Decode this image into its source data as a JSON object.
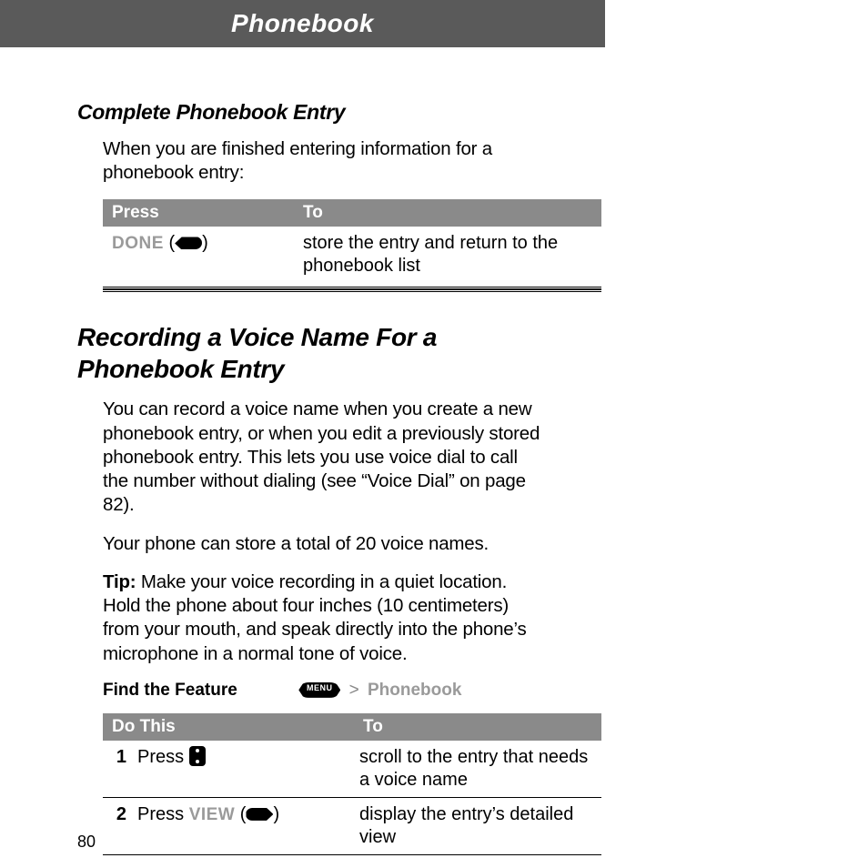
{
  "header": {
    "title": "Phonebook"
  },
  "page_number": "80",
  "section1": {
    "title": "Complete Phonebook Entry",
    "intro": "When you are finished entering information for a phonebook entry:",
    "table": {
      "headers": [
        "Press",
        "To"
      ],
      "rows": [
        {
          "press_label": "DONE",
          "press_paren_open": " (",
          "press_paren_close": ")",
          "key_icon": "softkey-left-icon",
          "to": "store the entry and return to the phonebook list"
        }
      ]
    }
  },
  "section2": {
    "title": "Recording a Voice Name For a Phonebook Entry",
    "p1": "You can record a voice name when you create a new phonebook entry, or when you edit a previously stored phonebook entry. This lets you use voice dial to call the number without dialing (see “Voice Dial” on page 82).",
    "p2": "Your phone can store a total of 20 voice names.",
    "tip_label": "Tip:",
    "tip_body": " Make your voice recording in a quiet location. Hold the phone about four inches (10 centimeters) from your mouth, and speak directly into the phone’s microphone in a normal tone of voice.",
    "find_feature": {
      "label": "Find the Feature",
      "menu_icon_label": "MENU",
      "sep": ">",
      "crumb": "Phonebook"
    },
    "table": {
      "headers": [
        "Do This",
        "To"
      ],
      "rows": [
        {
          "num": "1",
          "press_word": "Press ",
          "key_icon": "scroll-key-icon",
          "label": "",
          "to": "scroll to the entry that needs a voice name"
        },
        {
          "num": "2",
          "press_word": "Press ",
          "key_icon": "softkey-right-icon",
          "label": "VIEW",
          "paren_open": " (",
          "paren_close": ")",
          "to": "display the entry’s detailed view"
        }
      ]
    }
  }
}
